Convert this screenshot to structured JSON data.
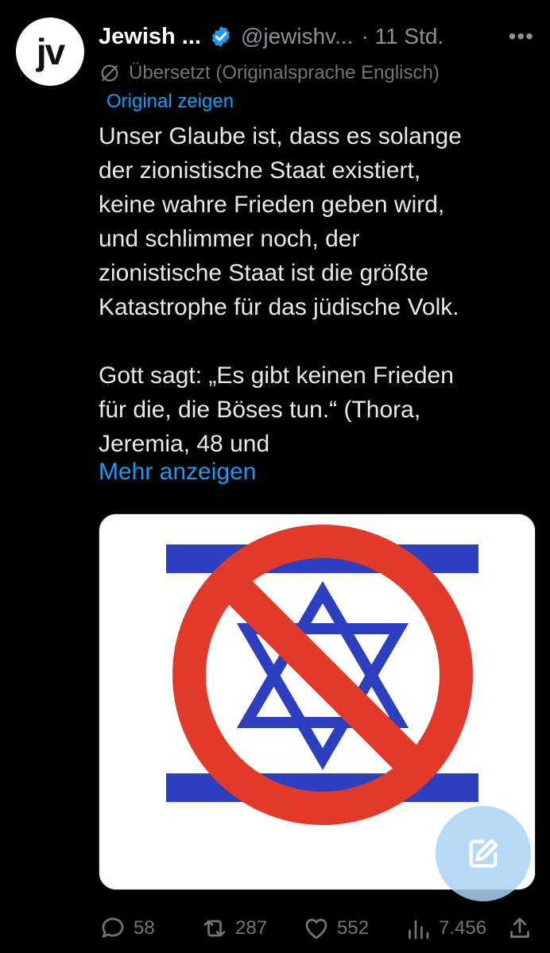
{
  "author": {
    "avatar_text": "jv",
    "display_name": "Jewish ...",
    "handle": "@jewishv...",
    "time": "· 11 Std."
  },
  "translation": {
    "notice": "Übersetzt (Originalsprache Englisch)",
    "show_original": "Original zeigen"
  },
  "tweet": {
    "text": "Unser Glaube ist, dass es solange\nder zionistische Staat existiert,\nkeine wahre Frieden geben wird,\nund schlimmer noch, der\nzionistische Staat ist die größte\nKatastrophe für das jüdische Volk.\n\nGott sagt: „Es gibt keinen Frieden\nfür die, die Böses tun.“ (Thora,\nJeremia, 48 und",
    "show_more": "Mehr anzeigen"
  },
  "stats": {
    "replies": "58",
    "reposts": "287",
    "likes": "552",
    "views": "7.456"
  },
  "colors": {
    "accent": "#1d9bf0",
    "muted": "#71767b",
    "flag_blue": "#2c3fbf",
    "prohibit_red": "#e23a2a"
  }
}
